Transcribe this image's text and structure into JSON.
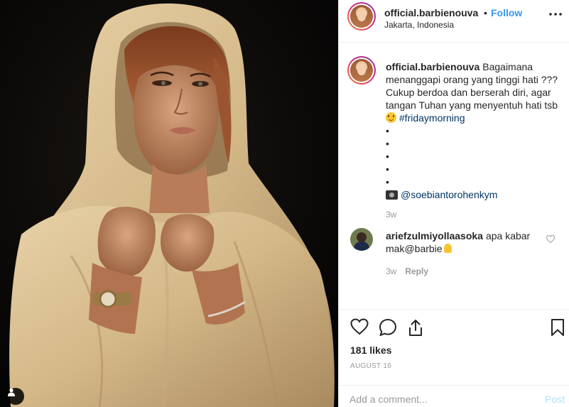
{
  "post": {
    "username": "official.barbienouva",
    "follow_label": "Follow",
    "dot": "•",
    "location": "Jakarta, Indonesia",
    "caption": {
      "line1": "Bagaimana menanggapi orang yang tinggi hati ??? Cukup berdoa dan berserah diri, agar tangan Tuhan yang menyentuh hati tsb",
      "hashtag": "#fridaymorning",
      "bullets": [
        "•",
        "•",
        "•",
        "•",
        "•"
      ],
      "mention": "@soebiantorohenkym",
      "time": "3w"
    },
    "comment": {
      "username": "ariefzulmiyollaasoka",
      "text": "apa kabar mak@barbie",
      "time": "3w",
      "reply_label": "Reply"
    },
    "likes": "181 likes",
    "date": "AUGUST 16",
    "add_comment_placeholder": "Add a comment...",
    "post_label": "Post"
  },
  "icons": {
    "more": "more-horizontal-icon",
    "heart": "heart-icon",
    "comment": "comment-bubble-icon",
    "share": "share-icon",
    "bookmark": "bookmark-icon",
    "user_tag": "user-tag-icon"
  },
  "colors": {
    "link": "#3897f0",
    "hashtag": "#003569",
    "muted": "#999999",
    "post_disabled": "#b2dffc"
  }
}
